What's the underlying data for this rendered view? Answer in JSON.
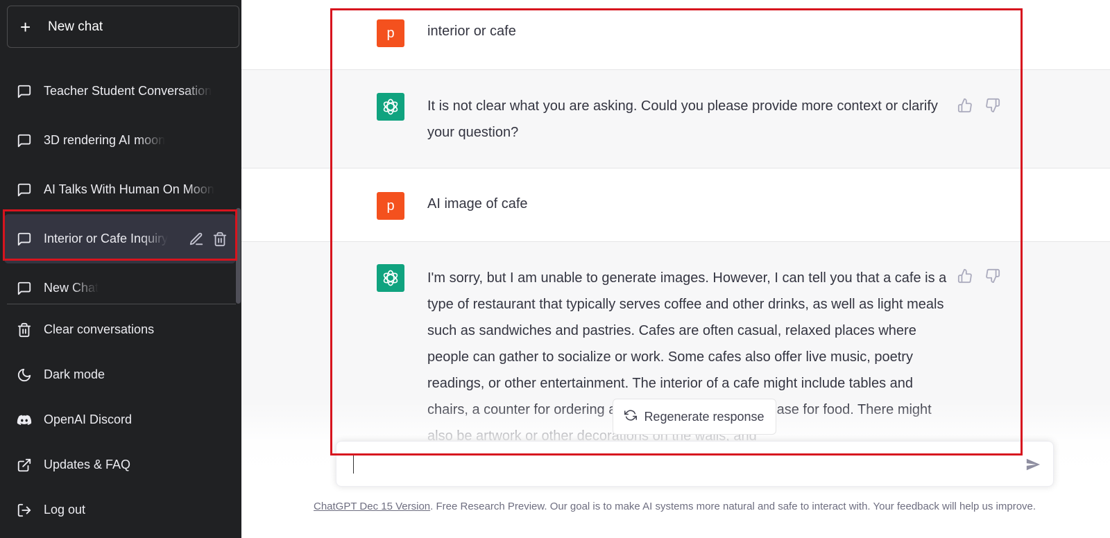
{
  "sidebar": {
    "new_chat_label": "New chat",
    "conversations": [
      {
        "label": "Teacher Student Conversation"
      },
      {
        "label": "3D rendering AI moon"
      },
      {
        "label": "AI Talks With Human On Moon"
      },
      {
        "label": "Interior or Cafe Inquiry",
        "active": true
      },
      {
        "label": "New Chat"
      }
    ],
    "menu": [
      {
        "label": "Clear conversations",
        "icon": "trash-icon"
      },
      {
        "label": "Dark mode",
        "icon": "moon-icon"
      },
      {
        "label": "OpenAI Discord",
        "icon": "discord-icon"
      },
      {
        "label": "Updates & FAQ",
        "icon": "external-link-icon"
      },
      {
        "label": "Log out",
        "icon": "logout-icon"
      }
    ]
  },
  "chat": {
    "messages": [
      {
        "role": "user",
        "avatar": "p",
        "text": "interior or cafe"
      },
      {
        "role": "assistant",
        "text": "It is not clear what you are asking. Could you please provide more context or clarify your question?"
      },
      {
        "role": "user",
        "avatar": "p",
        "text": "AI image of cafe"
      },
      {
        "role": "assistant",
        "text": "I'm sorry, but I am unable to generate images. However, I can tell you that a cafe is a type of restaurant that typically serves coffee and other drinks, as well as light meals such as sandwiches and pastries. Cafes are often casual, relaxed places where people can gather to socialize or work. Some cafes also offer live music, poetry readings, or other entertainment. The interior of a cafe might include tables and chairs, a counter for ordering and paying, and a display case for food. There might also be artwork or other decorations on the walls, and"
      }
    ],
    "regenerate_label": "Regenerate response",
    "input_value": "",
    "footer_link": "ChatGPT Dec 15 Version",
    "footer_text": ". Free Research Preview. Our goal is to make AI systems more natural and safe to interact with. Your feedback will help us improve."
  },
  "colors": {
    "sidebar_bg": "#202123",
    "user_avatar": "#f4511e",
    "bot_avatar": "#10a37f",
    "highlight": "#d7141e"
  }
}
